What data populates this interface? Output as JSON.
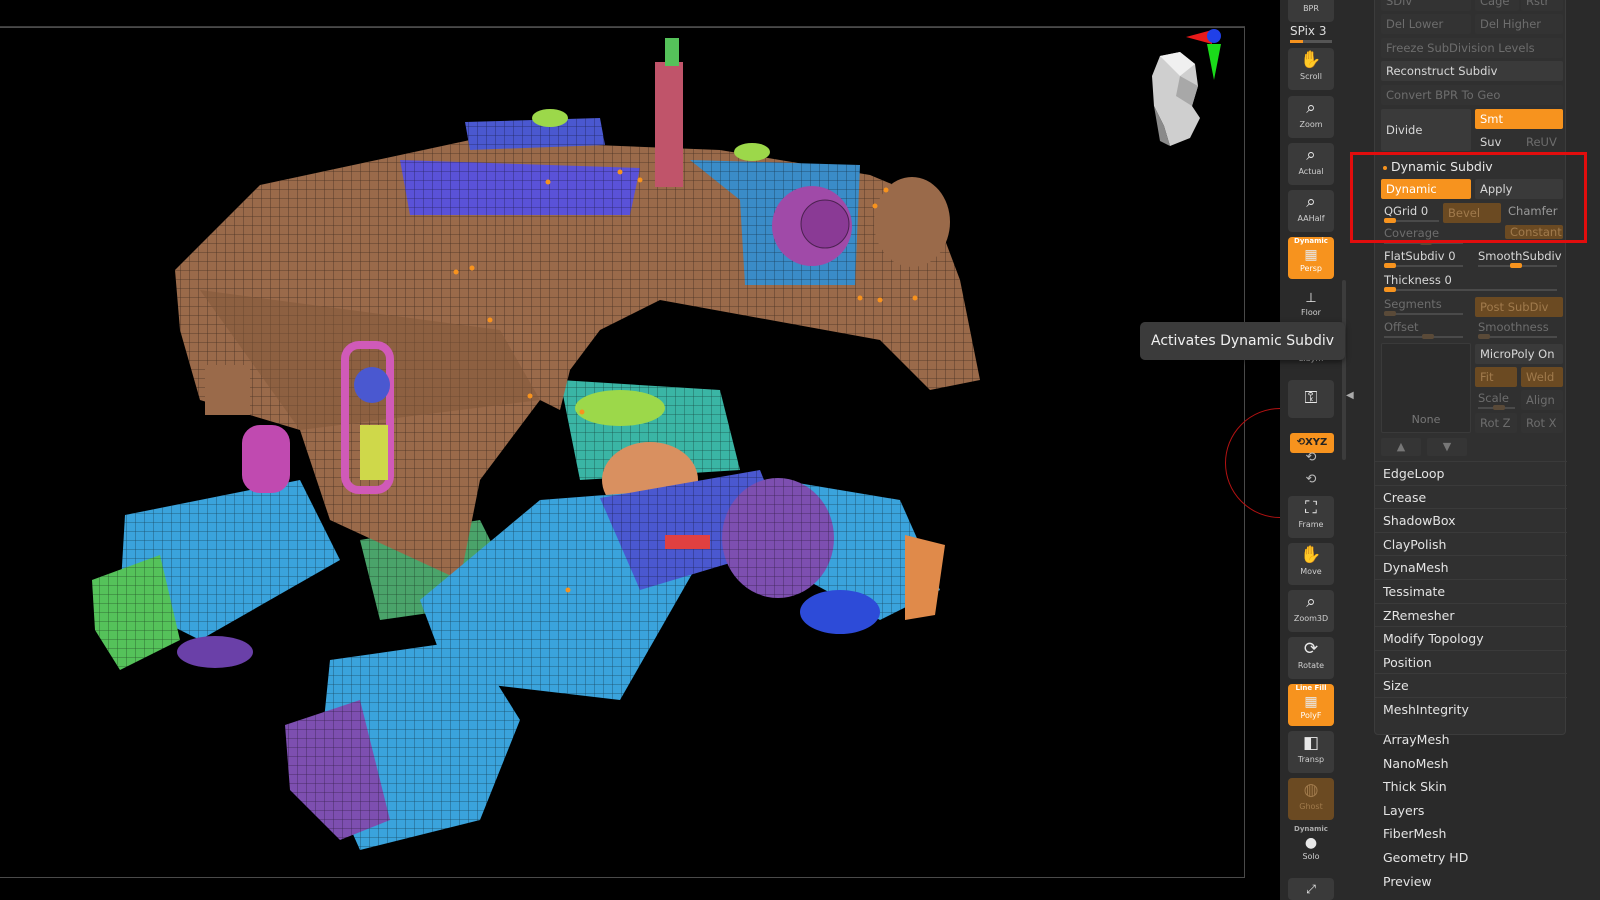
{
  "tooltip": {
    "text": "Activates Dynamic Subdiv"
  },
  "shelf": {
    "bpr_label": "BPR",
    "spix_label": "SPix 3",
    "scroll_label": "Scroll",
    "zoom_label": "Zoom",
    "actual_label": "Actual",
    "aahalf_label": "AAHalf",
    "persp_top": "Dynamic",
    "persp_label": "Persp",
    "floor_label": "Floor",
    "lsym_label": "L.Sym",
    "xyz_label": "XYZ",
    "frame_label": "Frame",
    "move_label": "Move",
    "zoom3d_label": "Zoom3D",
    "rotate_label": "Rotate",
    "polyf_top": "Line Fill",
    "polyf_label": "PolyF",
    "transp_label": "Transp",
    "ghost_label": "Ghost",
    "solo_top": "Dynamic",
    "solo_label": "Solo"
  },
  "panel": {
    "sdiv_label": "SDiv",
    "cage_label": "Cage",
    "rstr_label": "Rstr",
    "del_lower": "Del Lower",
    "del_higher": "Del Higher",
    "freeze_label": "Freeze SubDivision Levels",
    "reconstruct_label": "Reconstruct Subdiv",
    "convert_label": "Convert BPR To Geo",
    "divide_label": "Divide",
    "smt_label": "Smt",
    "suv_label": "Suv",
    "reuv_label": "ReUV",
    "dynamic_subdiv": {
      "header": "Dynamic Subdiv",
      "dynamic_label": "Dynamic",
      "apply_label": "Apply",
      "qgrid_label": "QGrid 0",
      "bevel_label": "Bevel",
      "chamfer_label": "Chamfer",
      "coverage_label": "Coverage",
      "constant_label": "Constant",
      "flatsubdiv_label": "FlatSubdiv 0",
      "smoothsubdiv_label": "SmoothSubdiv",
      "thickness_label": "Thickness 0",
      "segments_label": "Segments",
      "post_subdiv_label": "Post SubDiv",
      "offset_label": "Offset",
      "smoothness_label": "Smoothness",
      "micropoly_label": "MicroPoly On",
      "fit_label": "Fit",
      "weld_label": "Weld",
      "scale_label": "Scale",
      "align_label": "Align",
      "rotz_label": "Rot Z",
      "rotx_label": "Rot X",
      "preview_label": "None"
    },
    "sections": [
      "EdgeLoop",
      "Crease",
      "ShadowBox",
      "ClayPolish",
      "DynaMesh",
      "Tessimate",
      "ZRemesher",
      "Modify Topology",
      "Position",
      "Size",
      "MeshIntegrity"
    ],
    "menus": [
      "ArrayMesh",
      "NanoMesh",
      "Thick Skin",
      "Layers",
      "FiberMesh",
      "Geometry HD",
      "Preview"
    ]
  },
  "colors": {
    "accent": "#f7931e",
    "highlight": "#e20d0d",
    "mesh_brown": "#9a6a4a",
    "mesh_blue": "#3aa3dc",
    "mesh_purple": "#7d4fb0",
    "mesh_green": "#55c25a"
  }
}
